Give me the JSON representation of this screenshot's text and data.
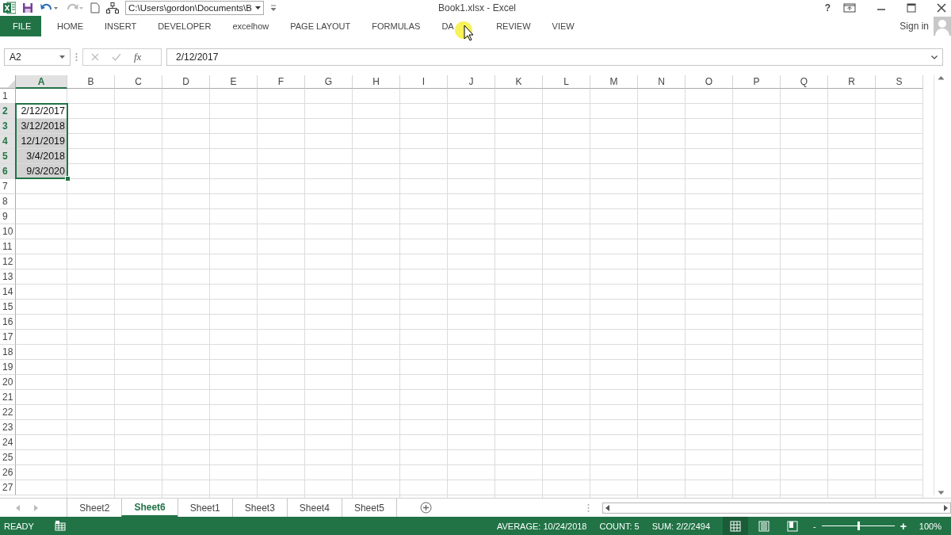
{
  "title_bar": {
    "path": "C:\\Users\\gordon\\Documents\\B",
    "title": "Book1.xlsx - Excel",
    "help": "?"
  },
  "ribbon": {
    "tabs": [
      {
        "label": "FILE",
        "kind": "file"
      },
      {
        "label": "HOME",
        "kind": "tab"
      },
      {
        "label": "INSERT",
        "kind": "tab"
      },
      {
        "label": "DEVELOPER",
        "kind": "tab"
      },
      {
        "label": "excelhow",
        "kind": "tab"
      },
      {
        "label": "PAGE LAYOUT",
        "kind": "tab"
      },
      {
        "label": "FORMULAS",
        "kind": "tab"
      },
      {
        "label": "DA",
        "kind": "tab"
      },
      {
        "label": "REVIEW",
        "kind": "tab"
      },
      {
        "label": "VIEW",
        "kind": "tab"
      }
    ],
    "sign_in": "Sign in"
  },
  "formula_bar": {
    "name_box": "A2",
    "function_label": "fx",
    "formula": "2/12/2017"
  },
  "columns": [
    {
      "label": "A",
      "selected": true
    },
    {
      "label": "B",
      "selected": false
    },
    {
      "label": "C",
      "selected": false
    },
    {
      "label": "D",
      "selected": false
    },
    {
      "label": "E",
      "selected": false
    },
    {
      "label": "F",
      "selected": false
    },
    {
      "label": "G",
      "selected": false
    },
    {
      "label": "H",
      "selected": false
    },
    {
      "label": "I",
      "selected": false
    },
    {
      "label": "J",
      "selected": false
    },
    {
      "label": "K",
      "selected": false
    },
    {
      "label": "L",
      "selected": false
    },
    {
      "label": "M",
      "selected": false
    },
    {
      "label": "N",
      "selected": false
    },
    {
      "label": "O",
      "selected": false
    },
    {
      "label": "P",
      "selected": false
    },
    {
      "label": "Q",
      "selected": false
    },
    {
      "label": "R",
      "selected": false
    },
    {
      "label": "S",
      "selected": false
    }
  ],
  "rows": [
    {
      "label": "1",
      "selected": false
    },
    {
      "label": "2",
      "selected": true,
      "cell": "2/12/2017",
      "active": true
    },
    {
      "label": "3",
      "selected": true,
      "cell": "3/12/2018",
      "active": false
    },
    {
      "label": "4",
      "selected": true,
      "cell": "12/1/2019",
      "active": false
    },
    {
      "label": "5",
      "selected": true,
      "cell": "3/4/2018",
      "active": false
    },
    {
      "label": "6",
      "selected": true,
      "cell": "9/3/2020",
      "active": false
    },
    {
      "label": "7",
      "selected": false
    },
    {
      "label": "8",
      "selected": false
    },
    {
      "label": "9",
      "selected": false
    },
    {
      "label": "10",
      "selected": false
    },
    {
      "label": "11",
      "selected": false
    },
    {
      "label": "12",
      "selected": false
    },
    {
      "label": "13",
      "selected": false
    },
    {
      "label": "14",
      "selected": false
    },
    {
      "label": "15",
      "selected": false
    },
    {
      "label": "16",
      "selected": false
    },
    {
      "label": "17",
      "selected": false
    },
    {
      "label": "18",
      "selected": false
    },
    {
      "label": "19",
      "selected": false
    },
    {
      "label": "20",
      "selected": false
    },
    {
      "label": "21",
      "selected": false
    },
    {
      "label": "22",
      "selected": false
    },
    {
      "label": "23",
      "selected": false
    },
    {
      "label": "24",
      "selected": false
    },
    {
      "label": "25",
      "selected": false
    },
    {
      "label": "26",
      "selected": false
    },
    {
      "label": "27",
      "selected": false
    }
  ],
  "sheets": [
    {
      "label": "Sheet2",
      "selected": false
    },
    {
      "label": "Sheet6",
      "selected": true
    },
    {
      "label": "Sheet1",
      "selected": false
    },
    {
      "label": "Sheet3",
      "selected": false
    },
    {
      "label": "Sheet4",
      "selected": false
    },
    {
      "label": "Sheet5",
      "selected": false
    }
  ],
  "status_bar": {
    "mode": "READY",
    "stats": [
      "AVERAGE: 10/24/2018",
      "COUNT: 5",
      "SUM: 2/2/2494"
    ],
    "views": [
      {
        "kind": "normal",
        "selected": true
      },
      {
        "kind": "page_layout",
        "selected": false
      },
      {
        "kind": "page_break",
        "selected": false
      }
    ],
    "zoom": {
      "minus": "-",
      "plus": "+",
      "level": 0.5,
      "reading": "100%"
    }
  }
}
